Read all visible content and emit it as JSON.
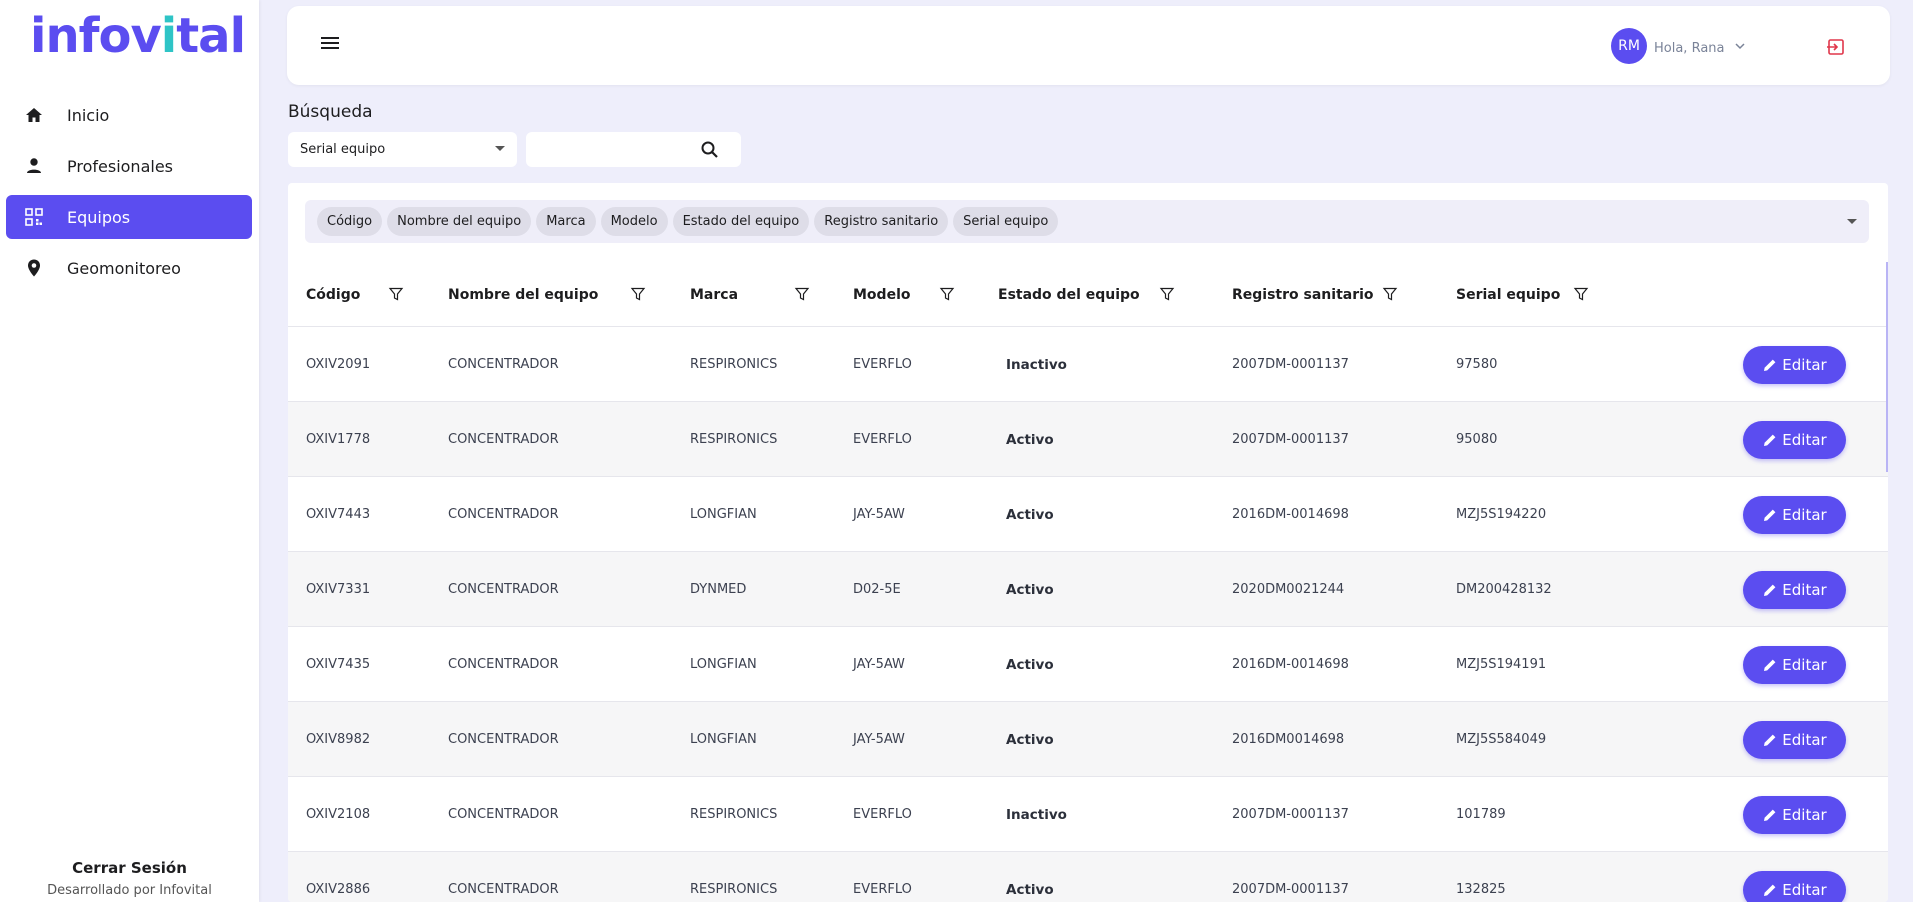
{
  "brand": {
    "logo_main": "infov",
    "logo_dot_i": "i",
    "logo_rest": "tal",
    "color": "#5b4df0",
    "accent": "#2ec4c6"
  },
  "sidebar": {
    "items": [
      {
        "label": "Inicio",
        "icon": "home-icon",
        "active": false
      },
      {
        "label": "Profesionales",
        "icon": "person-icon",
        "active": false
      },
      {
        "label": "Equipos",
        "icon": "qr-grid-icon",
        "active": true
      },
      {
        "label": "Geomonitoreo",
        "icon": "location-pin-icon",
        "active": false
      }
    ],
    "logout": "Cerrar Sesión",
    "developed_by": "Desarrollado por Infovital"
  },
  "header": {
    "avatar_initials": "RM",
    "greeting": "Hola, Rana",
    "menu_icon": "hamburger-icon",
    "exit_icon": "logout-icon"
  },
  "search": {
    "title": "Búsqueda",
    "selected_field": "Serial equipo",
    "input_value": "",
    "placeholder": ""
  },
  "chips": [
    "Código",
    "Nombre del equipo",
    "Marca",
    "Modelo",
    "Estado del equipo",
    "Registro sanitario",
    "Serial equipo"
  ],
  "table": {
    "columns": [
      "Código",
      "Nombre del equipo",
      "Marca",
      "Modelo",
      "Estado del equipo",
      "Registro sanitario",
      "Serial equipo"
    ],
    "edit_label": "Editar",
    "rows": [
      [
        "OXIV2091",
        "CONCENTRADOR",
        "RESPIRONICS",
        "EVERFLO",
        "Inactivo",
        "2007DM-0001137",
        "97580"
      ],
      [
        "OXIV1778",
        "CONCENTRADOR",
        "RESPIRONICS",
        "EVERFLO",
        "Activo",
        "2007DM-0001137",
        "95080"
      ],
      [
        "OXIV7443",
        "CONCENTRADOR",
        "LONGFIAN",
        "JAY-5AW",
        "Activo",
        "2016DM-0014698",
        "MZJ5S194220"
      ],
      [
        "OXIV7331",
        "CONCENTRADOR",
        "DYNMED",
        "D02-5E",
        "Activo",
        "2020DM0021244",
        "DM200428132"
      ],
      [
        "OXIV7435",
        "CONCENTRADOR",
        "LONGFIAN",
        "JAY-5AW",
        "Activo",
        "2016DM-0014698",
        "MZJ5S194191"
      ],
      [
        "OXIV8982",
        "CONCENTRADOR",
        "LONGFIAN",
        "JAY-5AW",
        "Activo",
        "2016DM0014698",
        "MZJ5S584049"
      ],
      [
        "OXIV2108",
        "CONCENTRADOR",
        "RESPIRONICS",
        "EVERFLO",
        "Inactivo",
        "2007DM-0001137",
        "101789"
      ],
      [
        "OXIV2886",
        "CONCENTRADOR",
        "RESPIRONICS",
        "EVERFLO",
        "Activo",
        "2007DM-0001137",
        "132825"
      ]
    ]
  }
}
